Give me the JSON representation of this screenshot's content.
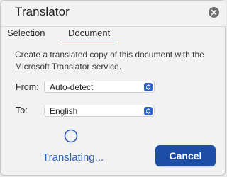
{
  "header": {
    "title": "Translator",
    "close_icon": "close-circle-icon"
  },
  "tabs": [
    {
      "label": "Selection",
      "selected": false
    },
    {
      "label": "Document",
      "selected": true
    }
  ],
  "document": {
    "description": "Create a translated copy of this document with the Microsoft Translator service.",
    "from": {
      "label": "From:",
      "value": "Auto-detect",
      "icon": "select-arrows-icon"
    },
    "to": {
      "label": "To:",
      "value": "English",
      "icon": "select-arrows-icon"
    }
  },
  "status": {
    "icon": "spinner-icon",
    "text": "Translating..."
  },
  "actions": {
    "cancel_label": "Cancel"
  },
  "colors": {
    "accent": "#1d4ea7",
    "status_text": "#2f62b0",
    "select_arrows": "#2f5fd0",
    "close_icon_bg": "#6b6b6b",
    "panel_bg": "#f2f2f2"
  }
}
